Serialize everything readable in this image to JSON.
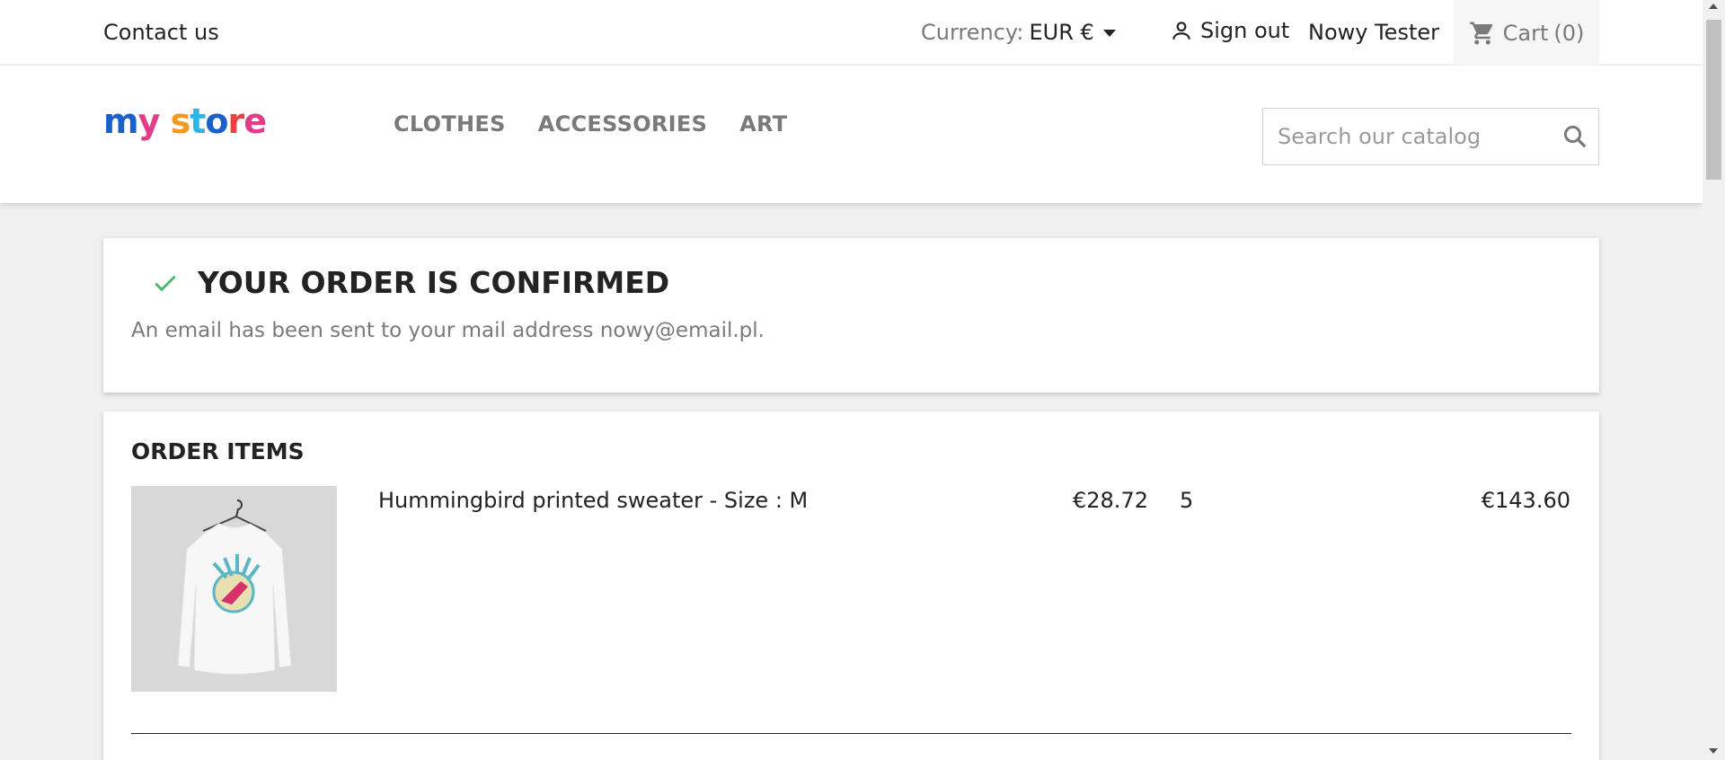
{
  "topbar": {
    "contact_label": "Contact us",
    "currency_label": "Currency:",
    "currency_value": "EUR €",
    "signout_label": "Sign out",
    "user_name": "Nowy Tester",
    "cart_label": "Cart",
    "cart_count": "(0)"
  },
  "header": {
    "logo_text": "my store",
    "menu": [
      {
        "label": "CLOTHES"
      },
      {
        "label": "ACCESSORIES"
      },
      {
        "label": "ART"
      }
    ],
    "search_placeholder": "Search our catalog"
  },
  "confirmation": {
    "title": "YOUR ORDER IS CONFIRMED",
    "message": "An email has been sent to your mail address nowy@email.pl."
  },
  "order_items": {
    "heading": "ORDER ITEMS",
    "items": [
      {
        "name": "Hummingbird printed sweater - Size : M",
        "unit_price": "€28.72",
        "quantity": "5",
        "total": "€143.60"
      }
    ]
  },
  "colors": {
    "accent_check": "#4cbb6c",
    "logo": [
      "#1b5fc8",
      "#e23c8b",
      "#f29a1e",
      "#29b6e8",
      "#ef4040"
    ]
  },
  "icons": {
    "user": "person-icon",
    "cart": "shopping-cart-icon",
    "search": "search-icon",
    "confirm": "checkmark-icon",
    "currency_dropdown": "caret-down-icon"
  }
}
